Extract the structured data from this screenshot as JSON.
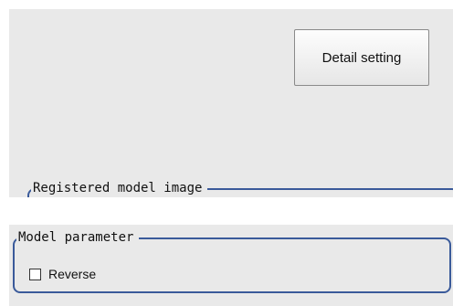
{
  "detail_button": {
    "label": "Detail setting"
  },
  "registered_model": {
    "legend": "Registered model image"
  },
  "model_parameter": {
    "legend": "Model parameter",
    "reverse": {
      "label": "Reverse",
      "checked": false
    }
  }
}
